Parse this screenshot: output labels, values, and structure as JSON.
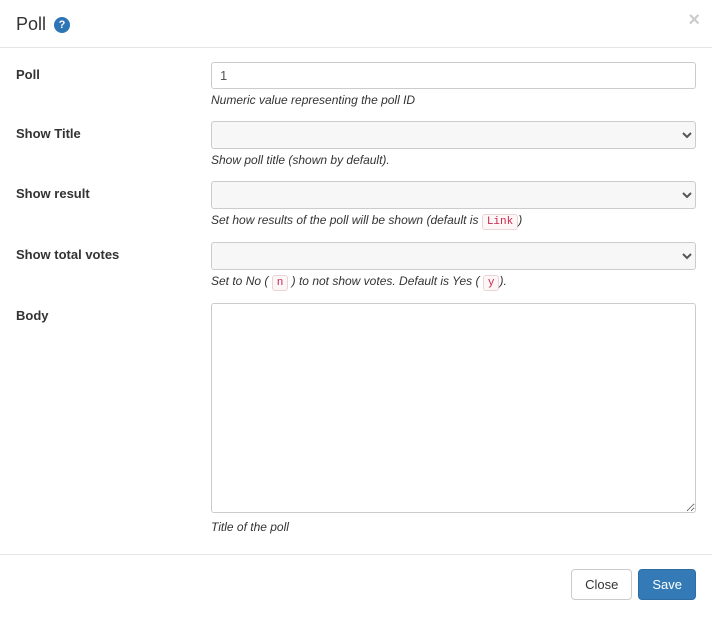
{
  "header": {
    "title": "Poll",
    "help_icon": "?",
    "close_icon": "×"
  },
  "fields": {
    "poll": {
      "label": "Poll",
      "value": "1",
      "help": "Numeric value representing the poll ID"
    },
    "show_title": {
      "label": "Show Title",
      "value": "",
      "help": "Show poll title (shown by default)."
    },
    "show_result": {
      "label": "Show result",
      "value": "",
      "help_before": "Set how results of the poll will be shown (default is ",
      "help_code": "Link",
      "help_after": ")"
    },
    "show_total_votes": {
      "label": "Show total votes",
      "value": "",
      "help_before": "Set to No ( ",
      "help_code1": "n",
      "help_mid": " ) to not show votes. Default is Yes ( ",
      "help_code2": "y",
      "help_after": ")."
    },
    "body": {
      "label": "Body",
      "value": "",
      "help": "Title of the poll"
    }
  },
  "footer": {
    "close": "Close",
    "save": "Save"
  }
}
